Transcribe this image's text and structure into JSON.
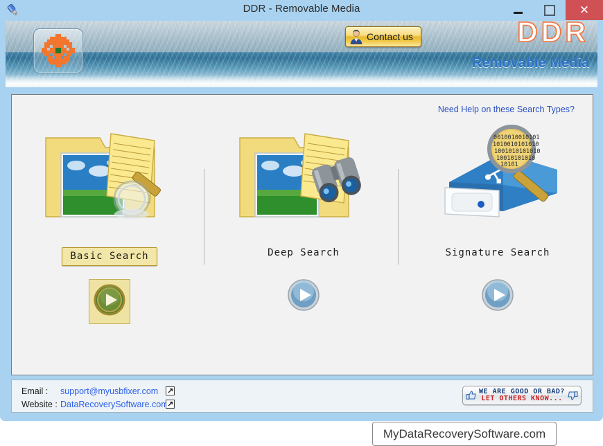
{
  "window": {
    "title": "DDR - Removable Media",
    "icon": "usb-drive-icon",
    "minimize_label": "–",
    "maximize_label": "□",
    "close_label": "✕"
  },
  "header": {
    "logo_icon": "checkered-flower-logo",
    "contact_label": "Contact us",
    "contact_icon": "person-icon",
    "brand": "DDR",
    "brand_sub": "Removable Media",
    "brand_color": "#f4743b",
    "brand_sub_color": "#2d72c6"
  },
  "main": {
    "help_link": "Need Help on these Search Types?",
    "help_link_color": "#2b4fc2",
    "options": [
      {
        "label": "Basic Search",
        "art_icon": "folder-photo-magnifier-icon",
        "play_icon": "play-button-gold",
        "selected": true
      },
      {
        "label": "Deep Search",
        "art_icon": "folder-photo-binoculars-icon",
        "play_icon": "play-button-blue",
        "selected": false
      },
      {
        "label": "Signature Search",
        "art_icon": "external-drive-binary-magnifier-icon",
        "play_icon": "play-button-blue",
        "selected": false
      }
    ]
  },
  "footer": {
    "email_label": "Email :",
    "email_value": "support@myusbfixer.com",
    "website_label": "Website :",
    "website_value": "DataRecoverySoftware.com",
    "external_link_icon": "external-link-icon",
    "rate_line1": "WE ARE GOOD OR BAD?",
    "rate_line2": "LET OTHERS KNOW...",
    "thumb_up_icon": "thumbs-up-icon",
    "thumb_down_icon": "thumbs-down-icon",
    "rate_line1_color": "#123a7a",
    "rate_line2_color": "#cc2020"
  },
  "watermark": {
    "text": "MyDataRecoverySoftware.com"
  }
}
